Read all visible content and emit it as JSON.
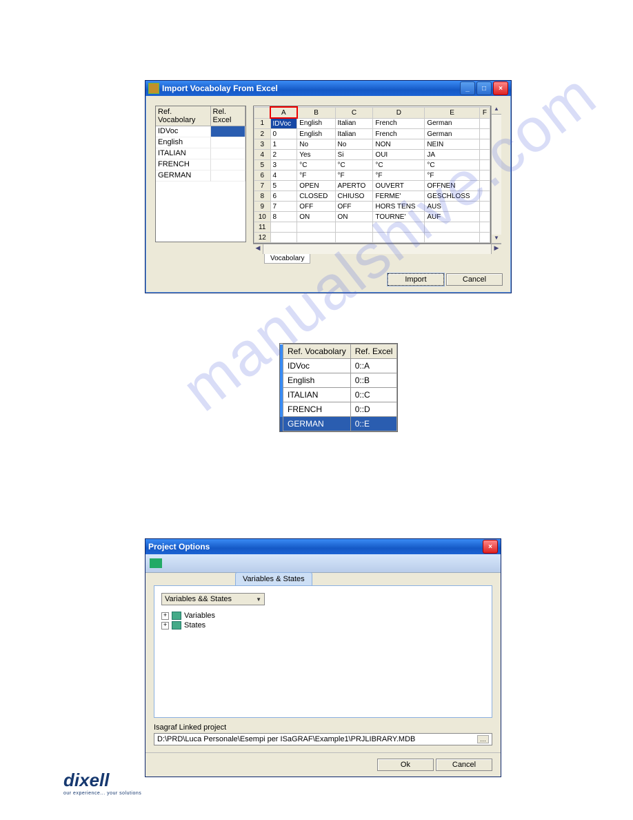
{
  "import_window": {
    "title": "Import Vocabolay From Excel",
    "left_table": {
      "headers": [
        "Ref. Vocabolary",
        "Rel. Excel"
      ],
      "rows": [
        "IDVoc",
        "English",
        "ITALIAN",
        "FRENCH",
        "GERMAN"
      ]
    },
    "grid": {
      "cols": [
        "",
        "A",
        "B",
        "C",
        "D",
        "E",
        "F"
      ],
      "rows": [
        {
          "n": "1",
          "cells": [
            "IDVoc",
            "English",
            "Italian",
            "French",
            "German",
            ""
          ]
        },
        {
          "n": "2",
          "cells": [
            "0",
            "English",
            "Italian",
            "French",
            "German",
            ""
          ]
        },
        {
          "n": "3",
          "cells": [
            "1",
            "No",
            "No",
            "NON",
            "NEIN",
            ""
          ]
        },
        {
          "n": "4",
          "cells": [
            "2",
            "Yes",
            "Si",
            "OUI",
            "JA",
            ""
          ]
        },
        {
          "n": "5",
          "cells": [
            "3",
            "°C",
            "°C",
            "°C",
            "°C",
            ""
          ]
        },
        {
          "n": "6",
          "cells": [
            "4",
            "°F",
            "°F",
            "°F",
            "°F",
            ""
          ]
        },
        {
          "n": "7",
          "cells": [
            "5",
            "OPEN",
            "APERTO",
            "OUVERT",
            "OFFNEN",
            ""
          ]
        },
        {
          "n": "8",
          "cells": [
            "6",
            "CLOSED",
            "CHIUSO",
            "FERME'",
            "GESCHLOSS",
            ""
          ]
        },
        {
          "n": "9",
          "cells": [
            "7",
            "OFF",
            "OFF",
            "HORS TENS",
            "AUS",
            ""
          ]
        },
        {
          "n": "10",
          "cells": [
            "8",
            "ON",
            "ON",
            "TOURNE'",
            "AUF",
            ""
          ]
        },
        {
          "n": "11",
          "cells": [
            "",
            "",
            "",
            "",
            "",
            ""
          ]
        },
        {
          "n": "12",
          "cells": [
            "",
            "",
            "",
            "",
            "",
            ""
          ]
        }
      ],
      "sheet_tab": "Vocabolary"
    },
    "buttons": {
      "import": "Import",
      "cancel": "Cancel"
    }
  },
  "mapping_table": {
    "headers": [
      "Ref. Vocabolary",
      "Ref. Excel"
    ],
    "rows": [
      {
        "v": "IDVoc",
        "e": "0::A"
      },
      {
        "v": "English",
        "e": "0::B"
      },
      {
        "v": "ITALIAN",
        "e": "0::C"
      },
      {
        "v": "FRENCH",
        "e": "0::D"
      },
      {
        "v": "GERMAN",
        "e": "0::E",
        "selected": true
      }
    ]
  },
  "options_window": {
    "title": "Project Options",
    "tab": "Variables & States",
    "combo": "Variables && States",
    "tree": [
      "Variables",
      "States"
    ],
    "path_label": "Isagraf Linked project",
    "path_value": "D:\\PRD\\Luca Personale\\Esempi per ISaGRAF\\Example1\\PRJLIBRARY.MDB",
    "buttons": {
      "ok": "Ok",
      "cancel": "Cancel"
    }
  },
  "logo": {
    "brand": "dixell",
    "tagline": "our experience... your solutions"
  }
}
